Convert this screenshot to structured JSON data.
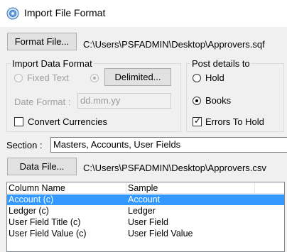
{
  "window": {
    "title": "Import File Format"
  },
  "format_file": {
    "button_label": "Format File...",
    "path": "C:\\Users\\PSFADMIN\\Desktop\\Approvers.sqf"
  },
  "import_data_format": {
    "legend": "Import Data Format",
    "fixed_text_label": "Fixed Text",
    "delimited_label": "Delimited...",
    "date_format_label": "Date Format :",
    "date_format_value": "dd.mm.yy",
    "convert_currencies_label": "Convert Currencies"
  },
  "post_details": {
    "legend": "Post details to",
    "hold_label": "Hold",
    "books_label": "Books",
    "errors_to_hold_label": "Errors To Hold",
    "selected": "Books",
    "errors_to_hold_checked": true
  },
  "section": {
    "label": "Section :",
    "value": "Masters, Accounts, User Fields"
  },
  "data_file": {
    "button_label": "Data File...",
    "path": "C:\\Users\\PSFADMIN\\Desktop\\Approvers.csv"
  },
  "list": {
    "columns": [
      "Column Name",
      "Sample"
    ],
    "rows": [
      {
        "column": "Account (c)",
        "sample": "Account",
        "selected": true
      },
      {
        "column": "Ledger (c)",
        "sample": "Ledger",
        "selected": false
      },
      {
        "column": "User Field Title (c)",
        "sample": "User Field",
        "selected": false
      },
      {
        "column": "User Field Value (c)",
        "sample": "User Field Value",
        "selected": false
      }
    ]
  },
  "colors": {
    "selection": "#3399ff",
    "background": "#f0f0f0"
  }
}
